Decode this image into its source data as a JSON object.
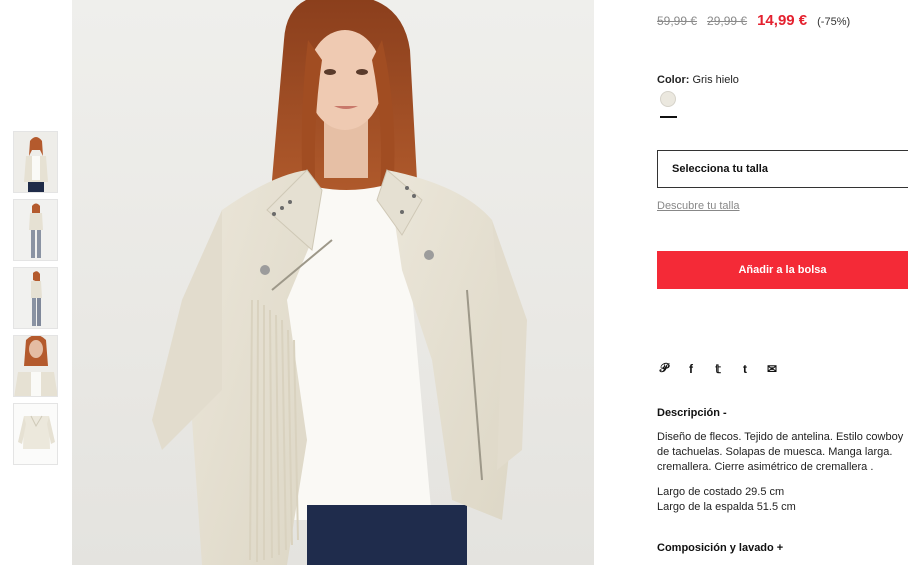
{
  "price": {
    "original": "59,99 €",
    "previous": "29,99 €",
    "current": "14,99 €",
    "discount": "(-75%)"
  },
  "color": {
    "label": "Color:",
    "value": "Gris hielo",
    "swatch_hex": "#ebe8df"
  },
  "size": {
    "select_label": "Selecciona tu talla",
    "discover_link": "Descubre tu talla"
  },
  "cart": {
    "add_label": "Añadir a la bolsa",
    "accent": "#f42a37"
  },
  "share": {
    "icons": [
      "pinterest-icon",
      "facebook-icon",
      "twitter-icon",
      "tumblr-icon",
      "mail-icon"
    ],
    "glyphs": [
      "𝒫",
      "f",
      "𝕥",
      "t",
      "✉"
    ]
  },
  "description": {
    "title": "Descripción -",
    "lines": [
      "Diseño de flecos. Tejido de antelina. Estilo cowboy",
      "de tachuelas. Solapas de muesca. Manga larga.",
      "cremallera. Cierre asimétrico de cremallera ."
    ],
    "measures": [
      "Largo de costado 29.5 cm",
      "Largo de la espalda 51.5 cm"
    ]
  },
  "composition": {
    "title": "Composición y lavado +"
  },
  "thumbnails": [
    "thumb-front",
    "thumb-full",
    "thumb-side",
    "thumb-detail",
    "thumb-product"
  ]
}
